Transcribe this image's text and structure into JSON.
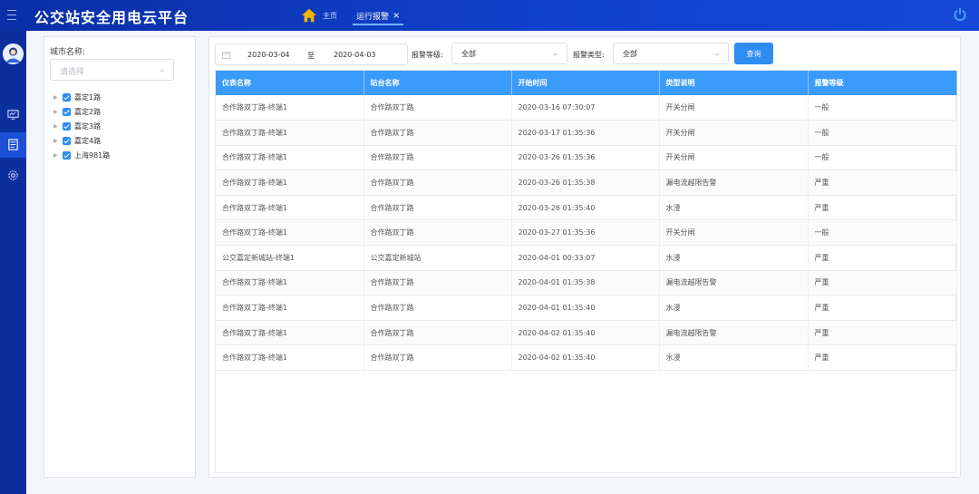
{
  "app": {
    "title": "公交站安全用电云平台"
  },
  "nav": {
    "home_label": "主页",
    "active_tab_label": "运行报警",
    "active_tab_close": "×"
  },
  "filter": {
    "city_label": "城市名称:",
    "city_placeholder": "请选择",
    "date_start": "2020-03-04",
    "date_separator": "至",
    "date_end": "2020-04-03",
    "level_label": "报警等级:",
    "level_value": "全部",
    "type_label": "报警类型:",
    "type_value": "全部",
    "query_label": "查询"
  },
  "tree": [
    {
      "label": "嘉定1路",
      "checked": true
    },
    {
      "label": "嘉定2路",
      "checked": true
    },
    {
      "label": "嘉定3路",
      "checked": true
    },
    {
      "label": "嘉定4路",
      "checked": true
    },
    {
      "label": "上海981路",
      "checked": true
    }
  ],
  "table": {
    "headers": [
      "仪表名称",
      "站台名称",
      "开始时间",
      "类型说明",
      "报警等级"
    ],
    "rows": [
      [
        "合作路双丁路-终端1",
        "合作路双丁路",
        "2020-03-16 07:30:07",
        "开关分闸",
        "一般"
      ],
      [
        "合作路双丁路-终端1",
        "合作路双丁路",
        "2020-03-17 01:35:36",
        "开关分闸",
        "一般"
      ],
      [
        "合作路双丁路-终端1",
        "合作路双丁路",
        "2020-03-26 01:35:36",
        "开关分闸",
        "一般"
      ],
      [
        "合作路双丁路-终端1",
        "合作路双丁路",
        "2020-03-26 01:35:38",
        "漏电流越限告警",
        "严重"
      ],
      [
        "合作路双丁路-终端1",
        "合作路双丁路",
        "2020-03-26 01:35:40",
        "水浸",
        "严重"
      ],
      [
        "合作路双丁路-终端1",
        "合作路双丁路",
        "2020-03-27 01:35:36",
        "开关分闸",
        "一般"
      ],
      [
        "公交嘉定新城站-终端1",
        "公交嘉定新城站",
        "2020-04-01 00:33:07",
        "水浸",
        "严重"
      ],
      [
        "合作路双丁路-终端1",
        "合作路双丁路",
        "2020-04-01 01:35:38",
        "漏电流越限告警",
        "严重"
      ],
      [
        "合作路双丁路-终端1",
        "合作路双丁路",
        "2020-04-01 01:35:40",
        "水浸",
        "严重"
      ],
      [
        "合作路双丁路-终端1",
        "合作路双丁路",
        "2020-04-02 01:35:40",
        "漏电流越限告警",
        "严重"
      ],
      [
        "合作路双丁路-终端1",
        "合作路双丁路",
        "2020-04-02 01:35:40",
        "水浸",
        "严重"
      ]
    ]
  },
  "colors": {
    "header_bg": "#0a2fa6",
    "accent": "#2f8cf0",
    "table_header": "#3b9bfb",
    "home_icon": "#f5b400"
  },
  "icons": [
    "menu-icon",
    "home-icon",
    "power-icon",
    "avatar",
    "monitor-icon",
    "document-icon",
    "settings-icon",
    "calendar-icon",
    "chevron-down-icon"
  ]
}
